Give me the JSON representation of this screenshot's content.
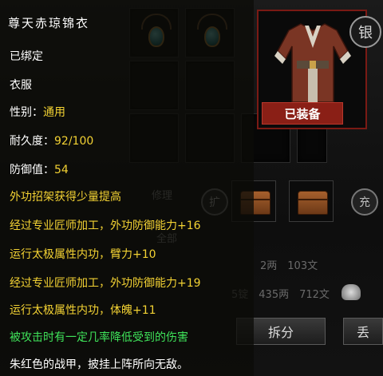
{
  "item": {
    "name": "尊天赤琼锦衣",
    "bind_status": "已绑定",
    "type": "衣服",
    "gender_label": "性别：",
    "gender_value": "通用",
    "durability_label": "耐久度：",
    "durability_value": "92/100",
    "defense_label": "防御值：",
    "defense_value": "54",
    "effects": [
      "外功招架获得少量提高",
      "经过专业匠师加工，外功防御能力+16",
      "运行太极属性内功，臂力+10",
      "经过专业匠师加工，外功防御能力+19",
      "运行太极属性内功，体魄+11"
    ],
    "special": "被攻击时有一定几率降低受到的伤害",
    "description": "朱红色的战甲，披挂上阵所向无敌。"
  },
  "equip_panel": {
    "equipped_badge": "已装备",
    "seal_char": "银"
  },
  "lower_panel": {
    "left_round_label": "扩",
    "right_round_label": "充",
    "repair_label": "修理",
    "all_label": "全部",
    "money_line1": "2两　103文",
    "money_line2": "5锭　435两　712文",
    "split_button": "拆分",
    "extra_button": "丢"
  },
  "colors": {
    "attribute_gold": "#f3d233",
    "special_green": "#3fe35a",
    "badge_red": "#8a1f16"
  }
}
